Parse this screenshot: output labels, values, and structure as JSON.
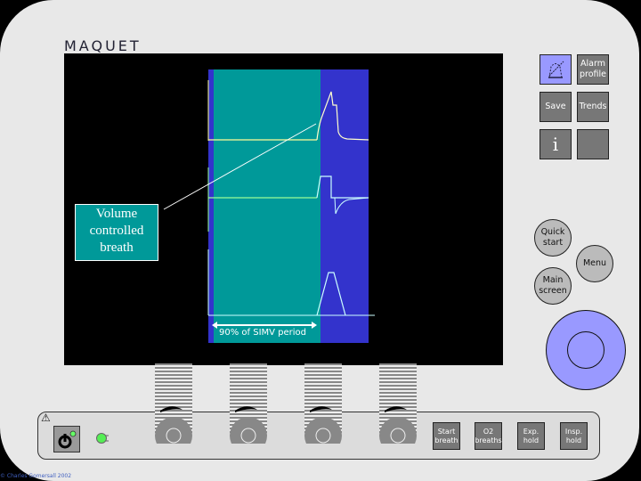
{
  "brand": {
    "logo": "MAQUET"
  },
  "screen": {
    "callout": {
      "line1": "Volume",
      "line2": "controlled",
      "line3": "breath"
    },
    "period_label": "90% of SIMV period",
    "colors": {
      "panel_blue": "#3333cc",
      "teal": "#009999",
      "pressure": "#ffff99",
      "flow": "#99ff99",
      "volume": "#ccffff"
    }
  },
  "right_buttons": {
    "alarm_silence": {
      "icon": "bell-crossed-icon"
    },
    "alarm_profile": "Alarm profile",
    "save": "Save",
    "trends": "Trends",
    "info": "i",
    "blank": ""
  },
  "round_buttons": {
    "quick_start": "Quick start",
    "menu": "Menu",
    "main_screen": "Main screen"
  },
  "bottom_buttons": {
    "start_breath": "Start breath",
    "o2_breaths": "O2 breaths",
    "exp_hold": "Exp. hold",
    "insp_hold": "Insp. hold"
  },
  "status": {
    "warning_icon": "⚠",
    "power": "power-icon"
  },
  "footer": {
    "copyright": "© Charles Gomersall 2002"
  }
}
